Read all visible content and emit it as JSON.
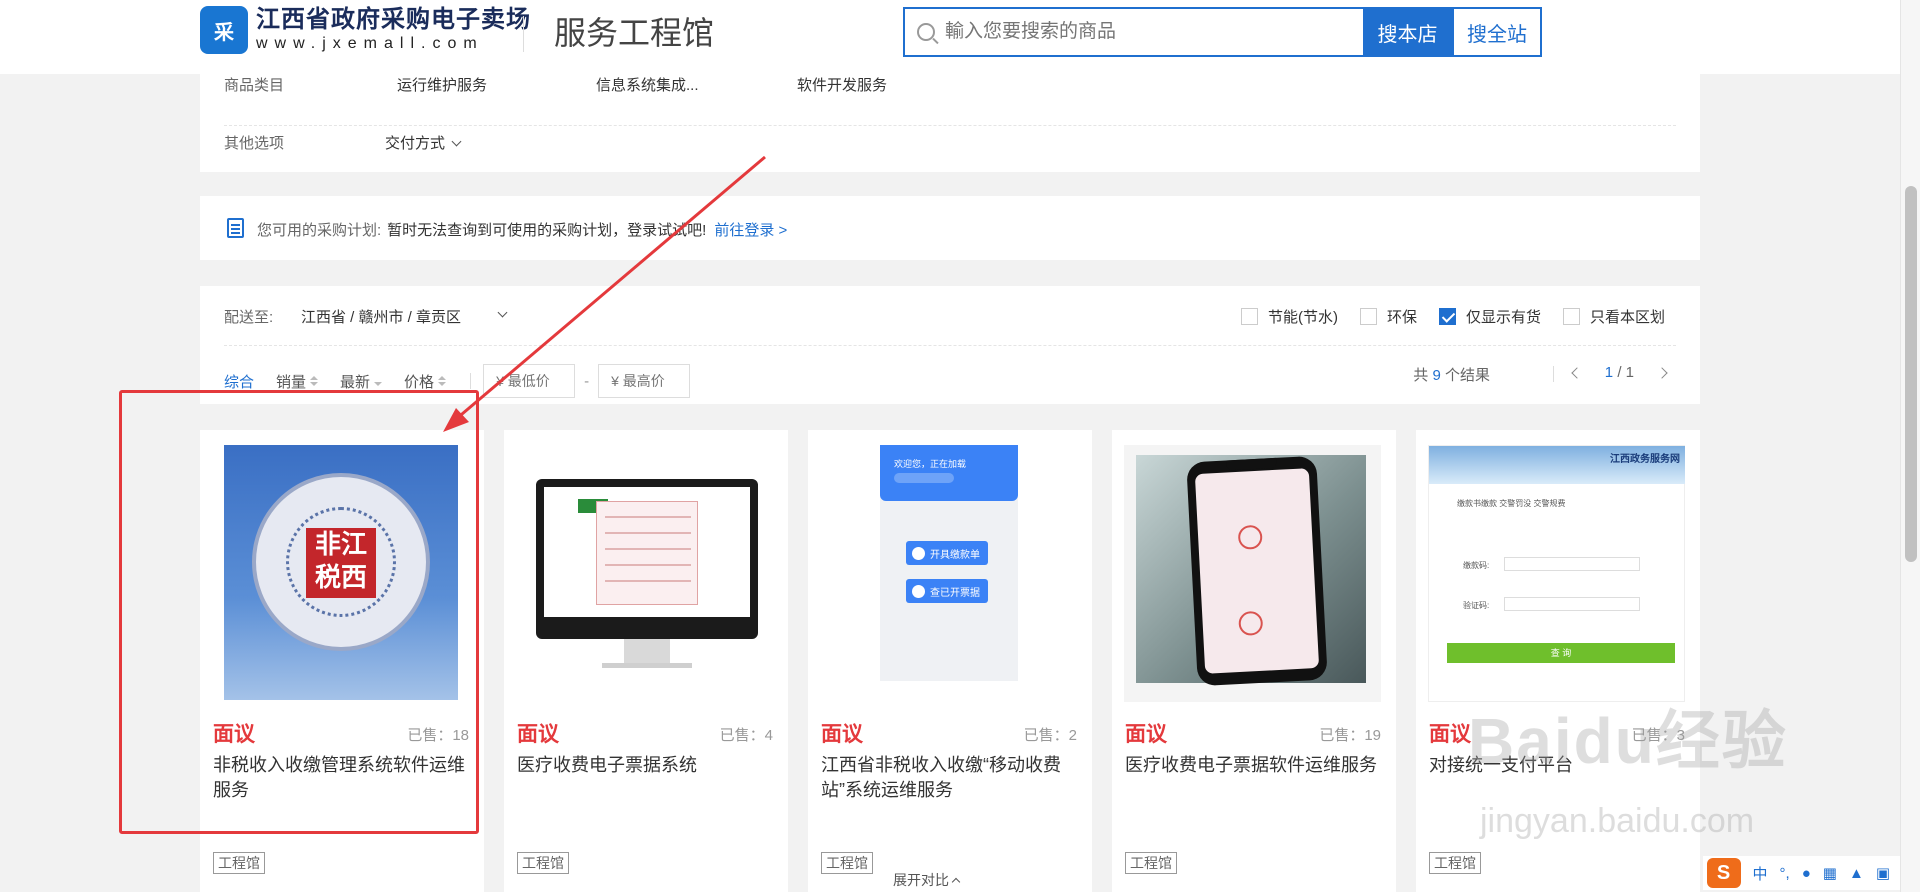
{
  "header": {
    "logo_badge": "采",
    "site_name": "江西省政府采购电子卖场",
    "site_url": "www.jxemall.com",
    "hall_title": "服务工程馆",
    "search": {
      "placeholder": "輸入您要搜索的商品",
      "search_store_label": "搜本店",
      "search_all_label": "搜全站"
    }
  },
  "filters": {
    "category_label": "商品类目",
    "categories": [
      "运行维护服务",
      "信息系统集成...",
      "软件开发服务"
    ],
    "other_label": "其他选项",
    "delivery_label": "交付方式"
  },
  "plan": {
    "label": "您可用的采购计划:",
    "message": "暂时无法查询到可使用的采购计划，登录试试吧!",
    "link": "前往登录 >"
  },
  "shipping": {
    "label": "配送至:",
    "value": "江西省 / 赣州市 / 章贡区"
  },
  "checkboxes": [
    {
      "label": "节能(节水)",
      "checked": false
    },
    {
      "label": "环保",
      "checked": false
    },
    {
      "label": "仅显示有货",
      "checked": true
    },
    {
      "label": "只看本区划",
      "checked": false
    }
  ],
  "sort": {
    "items": [
      "综合",
      "销量",
      "最新",
      "价格"
    ],
    "active": "综合",
    "min_price_placeholder": "¥ 最低价",
    "max_price_placeholder": "¥ 最高价",
    "dash": "-"
  },
  "results": {
    "prefix": "共",
    "count": "9",
    "suffix": "个结果",
    "page_current": "1",
    "page_total": "/ 1"
  },
  "products": [
    {
      "price": "面议",
      "sold": "已售：18",
      "title": "非税收入收缴管理系统软件运维服务",
      "tag": "工程馆",
      "seal_text": "非江税西"
    },
    {
      "price": "面议",
      "sold": "已售：4",
      "title": "医疗收费电子票据系统",
      "tag": "工程馆"
    },
    {
      "price": "面议",
      "sold": "已售：2",
      "title": "江西省非税收入收缴“移动收费站”系统运维服务",
      "tag": "工程馆",
      "app_greeting": "欢迎您，正在加载",
      "app_btn1": "开具缴款单",
      "app_btn2": "查已开票据"
    },
    {
      "price": "面议",
      "sold": "已售：19",
      "title": "医疗收费电子票据软件运维服务",
      "tag": "工程馆"
    },
    {
      "price": "面议",
      "sold": "已售：3",
      "title": "对接统一支付平台",
      "tag": "工程馆",
      "web_title": "江西政务服务网",
      "web_tabs": "缴款书缴款   交警罚没   交警规费",
      "web_label1": "缴款码:",
      "web_label2": "验证码:",
      "web_btn": "查 询"
    }
  ],
  "expand_label": "展开对比",
  "watermark": {
    "main": "Baidu经验",
    "sub": "jingyan.baidu.com"
  },
  "ime": {
    "badge": "S",
    "lang": "中",
    "dot": "°,"
  },
  "colors": {
    "brand_blue": "#1f6fcf",
    "price_red": "#e4393c",
    "annotation_red": "#e4393c"
  }
}
